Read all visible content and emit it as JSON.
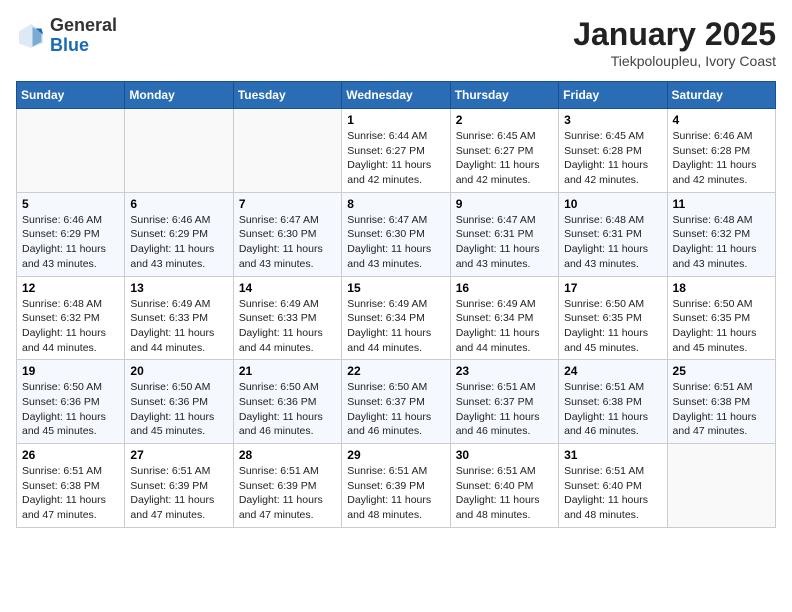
{
  "logo": {
    "general": "General",
    "blue": "Blue"
  },
  "header": {
    "title": "January 2025",
    "location": "Tiekpoloupleu, Ivory Coast"
  },
  "weekdays": [
    "Sunday",
    "Monday",
    "Tuesday",
    "Wednesday",
    "Thursday",
    "Friday",
    "Saturday"
  ],
  "weeks": [
    [
      {
        "day": "",
        "info": ""
      },
      {
        "day": "",
        "info": ""
      },
      {
        "day": "",
        "info": ""
      },
      {
        "day": "1",
        "sunrise": "Sunrise: 6:44 AM",
        "sunset": "Sunset: 6:27 PM",
        "daylight": "Daylight: 11 hours and 42 minutes."
      },
      {
        "day": "2",
        "sunrise": "Sunrise: 6:45 AM",
        "sunset": "Sunset: 6:27 PM",
        "daylight": "Daylight: 11 hours and 42 minutes."
      },
      {
        "day": "3",
        "sunrise": "Sunrise: 6:45 AM",
        "sunset": "Sunset: 6:28 PM",
        "daylight": "Daylight: 11 hours and 42 minutes."
      },
      {
        "day": "4",
        "sunrise": "Sunrise: 6:46 AM",
        "sunset": "Sunset: 6:28 PM",
        "daylight": "Daylight: 11 hours and 42 minutes."
      }
    ],
    [
      {
        "day": "5",
        "sunrise": "Sunrise: 6:46 AM",
        "sunset": "Sunset: 6:29 PM",
        "daylight": "Daylight: 11 hours and 43 minutes."
      },
      {
        "day": "6",
        "sunrise": "Sunrise: 6:46 AM",
        "sunset": "Sunset: 6:29 PM",
        "daylight": "Daylight: 11 hours and 43 minutes."
      },
      {
        "day": "7",
        "sunrise": "Sunrise: 6:47 AM",
        "sunset": "Sunset: 6:30 PM",
        "daylight": "Daylight: 11 hours and 43 minutes."
      },
      {
        "day": "8",
        "sunrise": "Sunrise: 6:47 AM",
        "sunset": "Sunset: 6:30 PM",
        "daylight": "Daylight: 11 hours and 43 minutes."
      },
      {
        "day": "9",
        "sunrise": "Sunrise: 6:47 AM",
        "sunset": "Sunset: 6:31 PM",
        "daylight": "Daylight: 11 hours and 43 minutes."
      },
      {
        "day": "10",
        "sunrise": "Sunrise: 6:48 AM",
        "sunset": "Sunset: 6:31 PM",
        "daylight": "Daylight: 11 hours and 43 minutes."
      },
      {
        "day": "11",
        "sunrise": "Sunrise: 6:48 AM",
        "sunset": "Sunset: 6:32 PM",
        "daylight": "Daylight: 11 hours and 43 minutes."
      }
    ],
    [
      {
        "day": "12",
        "sunrise": "Sunrise: 6:48 AM",
        "sunset": "Sunset: 6:32 PM",
        "daylight": "Daylight: 11 hours and 44 minutes."
      },
      {
        "day": "13",
        "sunrise": "Sunrise: 6:49 AM",
        "sunset": "Sunset: 6:33 PM",
        "daylight": "Daylight: 11 hours and 44 minutes."
      },
      {
        "day": "14",
        "sunrise": "Sunrise: 6:49 AM",
        "sunset": "Sunset: 6:33 PM",
        "daylight": "Daylight: 11 hours and 44 minutes."
      },
      {
        "day": "15",
        "sunrise": "Sunrise: 6:49 AM",
        "sunset": "Sunset: 6:34 PM",
        "daylight": "Daylight: 11 hours and 44 minutes."
      },
      {
        "day": "16",
        "sunrise": "Sunrise: 6:49 AM",
        "sunset": "Sunset: 6:34 PM",
        "daylight": "Daylight: 11 hours and 44 minutes."
      },
      {
        "day": "17",
        "sunrise": "Sunrise: 6:50 AM",
        "sunset": "Sunset: 6:35 PM",
        "daylight": "Daylight: 11 hours and 45 minutes."
      },
      {
        "day": "18",
        "sunrise": "Sunrise: 6:50 AM",
        "sunset": "Sunset: 6:35 PM",
        "daylight": "Daylight: 11 hours and 45 minutes."
      }
    ],
    [
      {
        "day": "19",
        "sunrise": "Sunrise: 6:50 AM",
        "sunset": "Sunset: 6:36 PM",
        "daylight": "Daylight: 11 hours and 45 minutes."
      },
      {
        "day": "20",
        "sunrise": "Sunrise: 6:50 AM",
        "sunset": "Sunset: 6:36 PM",
        "daylight": "Daylight: 11 hours and 45 minutes."
      },
      {
        "day": "21",
        "sunrise": "Sunrise: 6:50 AM",
        "sunset": "Sunset: 6:36 PM",
        "daylight": "Daylight: 11 hours and 46 minutes."
      },
      {
        "day": "22",
        "sunrise": "Sunrise: 6:50 AM",
        "sunset": "Sunset: 6:37 PM",
        "daylight": "Daylight: 11 hours and 46 minutes."
      },
      {
        "day": "23",
        "sunrise": "Sunrise: 6:51 AM",
        "sunset": "Sunset: 6:37 PM",
        "daylight": "Daylight: 11 hours and 46 minutes."
      },
      {
        "day": "24",
        "sunrise": "Sunrise: 6:51 AM",
        "sunset": "Sunset: 6:38 PM",
        "daylight": "Daylight: 11 hours and 46 minutes."
      },
      {
        "day": "25",
        "sunrise": "Sunrise: 6:51 AM",
        "sunset": "Sunset: 6:38 PM",
        "daylight": "Daylight: 11 hours and 47 minutes."
      }
    ],
    [
      {
        "day": "26",
        "sunrise": "Sunrise: 6:51 AM",
        "sunset": "Sunset: 6:38 PM",
        "daylight": "Daylight: 11 hours and 47 minutes."
      },
      {
        "day": "27",
        "sunrise": "Sunrise: 6:51 AM",
        "sunset": "Sunset: 6:39 PM",
        "daylight": "Daylight: 11 hours and 47 minutes."
      },
      {
        "day": "28",
        "sunrise": "Sunrise: 6:51 AM",
        "sunset": "Sunset: 6:39 PM",
        "daylight": "Daylight: 11 hours and 47 minutes."
      },
      {
        "day": "29",
        "sunrise": "Sunrise: 6:51 AM",
        "sunset": "Sunset: 6:39 PM",
        "daylight": "Daylight: 11 hours and 48 minutes."
      },
      {
        "day": "30",
        "sunrise": "Sunrise: 6:51 AM",
        "sunset": "Sunset: 6:40 PM",
        "daylight": "Daylight: 11 hours and 48 minutes."
      },
      {
        "day": "31",
        "sunrise": "Sunrise: 6:51 AM",
        "sunset": "Sunset: 6:40 PM",
        "daylight": "Daylight: 11 hours and 48 minutes."
      },
      {
        "day": "",
        "info": ""
      }
    ]
  ]
}
